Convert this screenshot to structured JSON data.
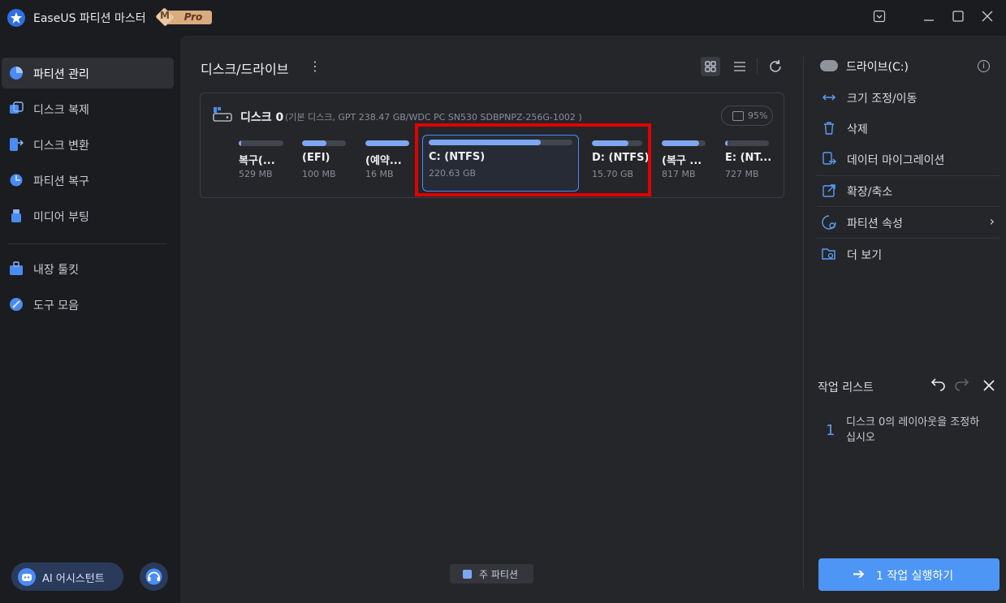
{
  "app": {
    "title": "EaseUS 파티션 마스터",
    "badge_letter": "M",
    "badge_text": "Pro",
    "window_controls": [
      "menu-icon",
      "minimize-icon",
      "maximize-icon",
      "close-icon"
    ]
  },
  "sidebar": {
    "items": [
      {
        "label": "파티션 관리",
        "icon": "pie-chart-icon",
        "active": true
      },
      {
        "label": "디스크 복제",
        "icon": "clone-icon",
        "active": false
      },
      {
        "label": "디스크 변환",
        "icon": "convert-icon",
        "active": false
      },
      {
        "label": "파티션 복구",
        "icon": "recover-icon",
        "active": false
      },
      {
        "label": "미디어 부팅",
        "icon": "usb-icon",
        "active": false
      },
      {
        "label": "내장 툴킷",
        "icon": "toolkit-icon",
        "active": false
      },
      {
        "label": "도구 모음",
        "icon": "tools-icon",
        "active": false
      }
    ],
    "ai_assistant": "AI 어시스턴트",
    "support_icon": "headset-icon"
  },
  "main": {
    "title": "디스크/드라이브",
    "disk": {
      "name": "디스크 0",
      "info": "(기본 디스크, GPT 238.47 GB/WDC PC SN530 SDBPNPZ-256G-1002 )",
      "usage": "95%",
      "partitions": [
        {
          "name": "복구(...",
          "size": "529 MB",
          "fill": 0.05
        },
        {
          "name": "(EFI)",
          "size": "100 MB",
          "fill": 0.55
        },
        {
          "name": "(예약...",
          "size": "16 MB",
          "fill": 1.0
        },
        {
          "name": "C: (NTFS)",
          "size": "220.63 GB",
          "fill": 0.78,
          "selected": true
        },
        {
          "name": "D: (NTFS)",
          "size": "15.70 GB",
          "fill": 0.72
        },
        {
          "name": "(복구 ...",
          "size": "817 MB",
          "fill": 0.85
        },
        {
          "name": "E: (NT...",
          "size": "727 MB",
          "fill": 0.06
        }
      ]
    },
    "legend": {
      "label": "주 파티션",
      "color": "#7fa6f0"
    }
  },
  "right_panel": {
    "drive_label": "드라이브(C:)",
    "actions": [
      {
        "label": "크기 조정/이동",
        "icon": "resize-icon"
      },
      {
        "label": "삭제",
        "icon": "trash-icon"
      },
      {
        "label": "데이터 마이그레이션",
        "icon": "migrate-icon"
      },
      {
        "label": "확장/축소",
        "icon": "extend-icon"
      },
      {
        "label": "파티션 속성",
        "icon": "properties-icon",
        "chevron": true
      },
      {
        "label": "더 보기",
        "icon": "more-folder-icon"
      }
    ],
    "task_list": {
      "title": "작업 리스트",
      "items": [
        {
          "num": "1",
          "text": "디스크 0의 레이아웃을 조정하십시오"
        }
      ]
    },
    "run_button": "1 작업 실행하기"
  },
  "colors": {
    "accent": "#4d96f5",
    "selection": "#e00000",
    "partition_fill": "#7fa6f0"
  }
}
